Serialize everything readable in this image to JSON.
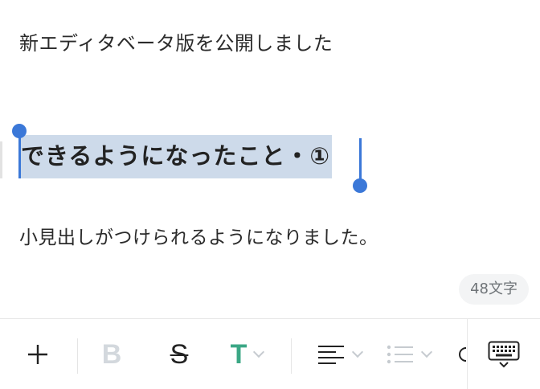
{
  "editor": {
    "title": "新エディタベータ版を公開しました",
    "heading": "できるようになったこと・①",
    "body": "小見出しがつけられるようになりました。",
    "char_count": "48文字"
  },
  "toolbar": {
    "buttons": [
      {
        "icon": "plus-icon"
      },
      {
        "icon": "bold-icon",
        "label": "B"
      },
      {
        "icon": "strikethrough-icon",
        "label": "S"
      },
      {
        "icon": "text-style-icon",
        "label": "T"
      },
      {
        "icon": "align-left-icon"
      },
      {
        "icon": "bulleted-list-icon"
      },
      {
        "icon": "keyboard-icon"
      }
    ]
  },
  "colors": {
    "selection": "#cddaea",
    "caret": "#3b78d8",
    "accent_green": "#3ba785",
    "disabled_gray": "#d3d8dd"
  }
}
